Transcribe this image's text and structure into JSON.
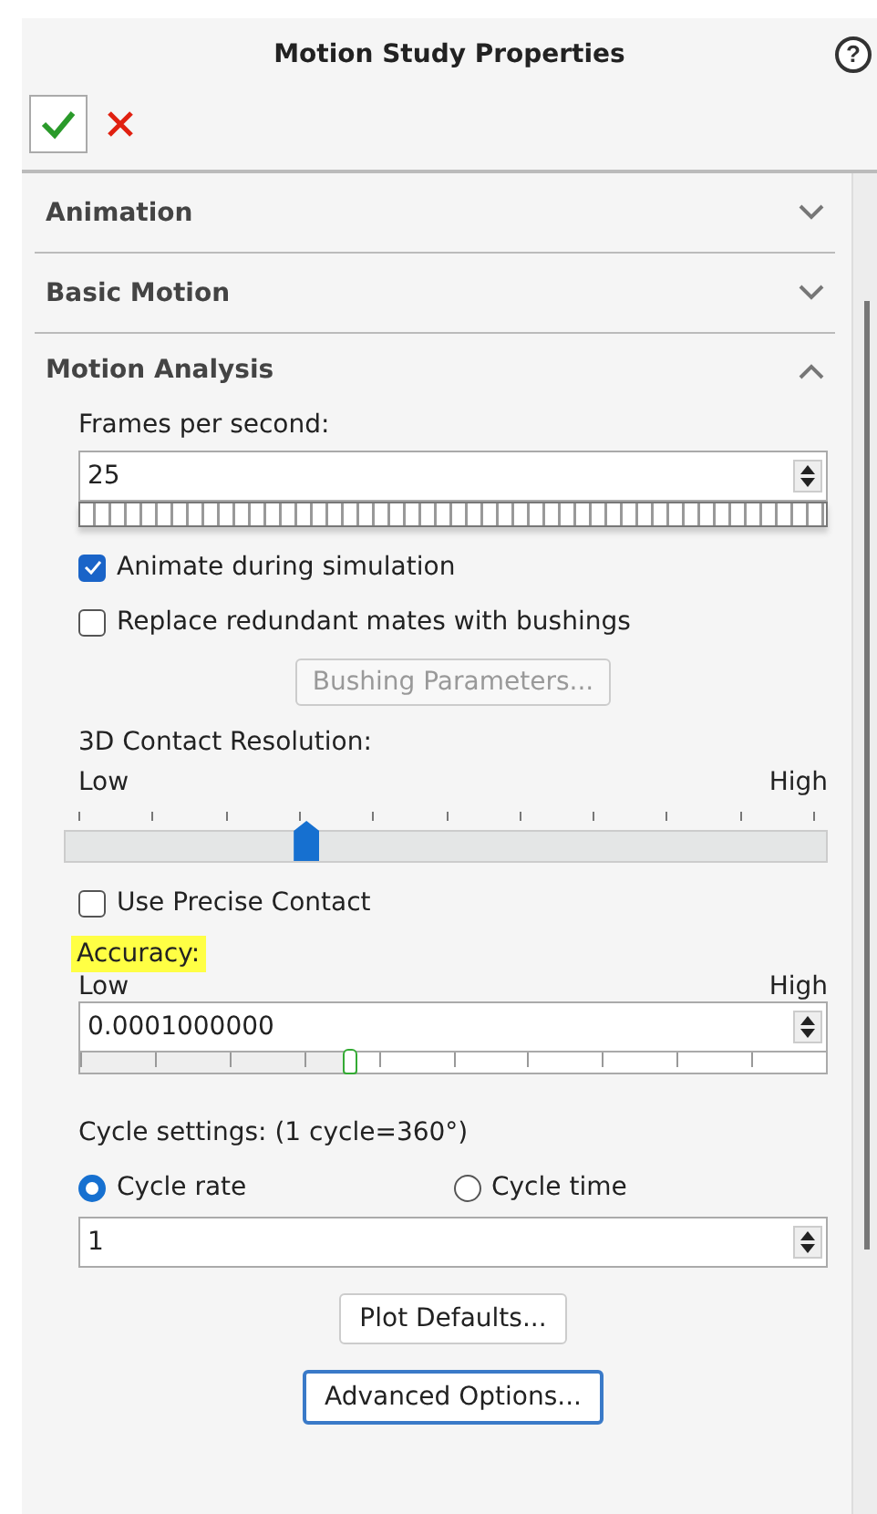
{
  "panel": {
    "title": "Motion Study Properties",
    "help": "?"
  },
  "sections": [
    {
      "title": "Animation",
      "expanded": false
    },
    {
      "title": "Basic Motion",
      "expanded": false
    },
    {
      "title": "Motion Analysis",
      "expanded": true
    }
  ],
  "frames": {
    "label": "Frames per second:",
    "value": "25"
  },
  "options": [
    {
      "label": "Animate during simulation",
      "checked": true
    },
    {
      "label": "Replace redundant mates with bushings",
      "checked": false
    }
  ],
  "bushing_button": {
    "label": "Bushing Parameters...",
    "disabled": true
  },
  "contact_resolution": {
    "label": "3D Contact Resolution:",
    "low": "Low",
    "high": "High",
    "level": 0.3
  },
  "precise_contact": {
    "label": "Use Precise Contact",
    "checked": false
  },
  "accuracy": {
    "label": "Accuracy:",
    "highlighted": true,
    "low": "Low",
    "high": "High",
    "value": "0.0001000000",
    "level": 0.36
  },
  "cycle": {
    "label": "Cycle settings: (1 cycle=360°)",
    "modes": [
      {
        "label": "Cycle rate",
        "selected": true
      },
      {
        "label": "Cycle time",
        "selected": false
      }
    ],
    "value": "1"
  },
  "buttons": [
    {
      "label": "Plot Defaults...",
      "focused": false
    },
    {
      "label": "Advanced Options...",
      "focused": true
    }
  ]
}
